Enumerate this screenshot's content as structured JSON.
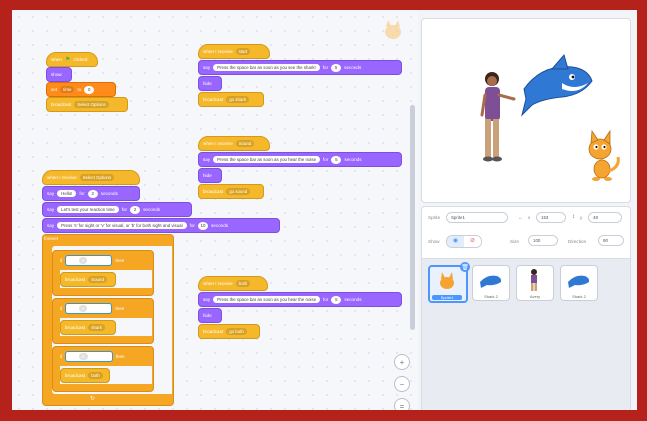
{
  "scripts": {
    "s1": {
      "hat": "when",
      "hat2": "clicked",
      "show": "show",
      "set": "set",
      "set_var": "time",
      "set_to": "to",
      "set_val": "0",
      "broadcast": "broadcast",
      "broadcast_msg": "Select Options"
    },
    "s2": {
      "hat": "when I receive",
      "msg": "start",
      "say": "say",
      "text": "Press the space bar as soon as you see the shark!",
      "for": "for",
      "secs": "5",
      "seconds": "seconds",
      "hide": "hide",
      "broadcast": "broadcast",
      "broadcast_msg": "go shark"
    },
    "s3": {
      "hat": "when I receive",
      "msg": "Sound",
      "say": "say",
      "text": "Press the space bar as soon as you hear the noise",
      "for": "for",
      "secs": "5",
      "seconds": "seconds",
      "hide": "hide",
      "broadcast": "broadcast",
      "broadcast_msg": "go sound"
    },
    "s4": {
      "hat": "when I receive",
      "msg": "Select Options",
      "say": "say",
      "say1": "Hello!",
      "say1_for": "for",
      "say1_secs": "2",
      "say1_seconds": "seconds",
      "say2": "Let's test your reaction time",
      "say2_secs": "2",
      "say3": "Press 's' for sight or 'v' for visual, or 'b' for both sight and visual",
      "say3_secs": "10",
      "forever": "forever",
      "if": "if",
      "then": "then",
      "key": "key",
      "pressed": "pressed?",
      "k1": "s",
      "k2": "v",
      "k3": "b",
      "bc": "broadcast",
      "bc1": "Sound",
      "bc2": "shark",
      "bc3": "both"
    },
    "s5": {
      "hat": "when I receive",
      "msg": "both",
      "say": "say",
      "text": "Press the space bar as soon as you hear the noise",
      "for": "for",
      "secs": "5",
      "seconds": "seconds",
      "hide": "hide",
      "broadcast": "broadcast",
      "broadcast_msg": "go both"
    }
  },
  "zoom": {
    "in": "+",
    "out": "−",
    "reset": "="
  },
  "sprite_info": {
    "sprite_label": "Sprite",
    "sprite_name": "Sprite1",
    "x_label": "x",
    "x_val": "153",
    "y_label": "y",
    "y_val": "48",
    "show_label": "Show",
    "size_label": "Size",
    "size_val": "100",
    "direction_label": "Direction",
    "direction_val": "90"
  },
  "sprite_list": [
    "Sprite1",
    "Shark 2",
    "Avery",
    "Shark 2"
  ],
  "colors": {
    "events": "#f5b82a",
    "looks": "#9966ff",
    "control": "#f5a623",
    "variables": "#ff8c1a",
    "sensing": "#5cb1d6",
    "accent": "#4c97ff",
    "frame": "#b5221c"
  }
}
